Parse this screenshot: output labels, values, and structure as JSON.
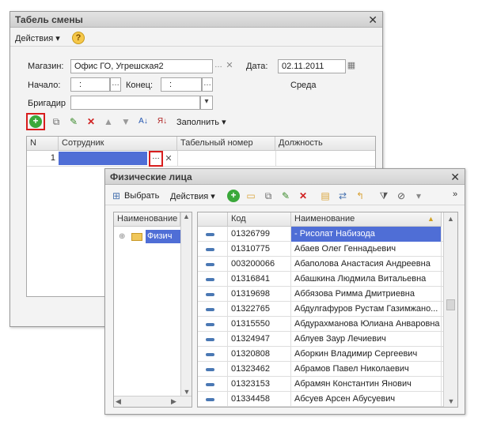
{
  "back_window": {
    "title": "Табель смены",
    "actions_menu": "Действия",
    "help_icon": "?",
    "store_label": "Магазин:",
    "store_value": "Офис ГО, Угрешская2",
    "date_label": "Дата:",
    "date_value": "02.11.2011",
    "start_label": "Начало:",
    "start_value": ":",
    "end_label": "Конец:",
    "end_value": ":",
    "weekday": "Среда",
    "foreman_label": "Бригадир",
    "fill_label": "Заполнить",
    "columns": [
      "N",
      "Сотрудник",
      "Табельный номер",
      "Должность"
    ],
    "row_number": "1"
  },
  "front_window": {
    "title": "Физические лица",
    "select_label": "Выбрать",
    "actions_menu": "Действия",
    "tree_header": "Наименование",
    "tree_item": "Физич",
    "columns": [
      "Код",
      "Наименование"
    ],
    "rows": [
      {
        "code": "01326799",
        "name": "- Рисолат Набизода"
      },
      {
        "code": "01310775",
        "name": "Абаев Олег Геннадьевич"
      },
      {
        "code": "003200066",
        "name": "Абаполова Анастасия Андреевна"
      },
      {
        "code": "01316841",
        "name": "Абашкина Людмила Витальевна"
      },
      {
        "code": "01319698",
        "name": "Аббязова Римма Дмитриевна"
      },
      {
        "code": "01322765",
        "name": "Абдулгафуров Рустам Газимжано..."
      },
      {
        "code": "01315550",
        "name": "Абдурахманова Юлиана Анваровна"
      },
      {
        "code": "01324947",
        "name": "Аблуев Заур Лечиевич"
      },
      {
        "code": "01320808",
        "name": "Аборкин Владимир Сергеевич"
      },
      {
        "code": "01323462",
        "name": "Абрамов Павел Николаевич"
      },
      {
        "code": "01323153",
        "name": "Абрамян Константин Янович"
      },
      {
        "code": "01334458",
        "name": "Абсуев Арсен Абусуевич"
      }
    ]
  }
}
